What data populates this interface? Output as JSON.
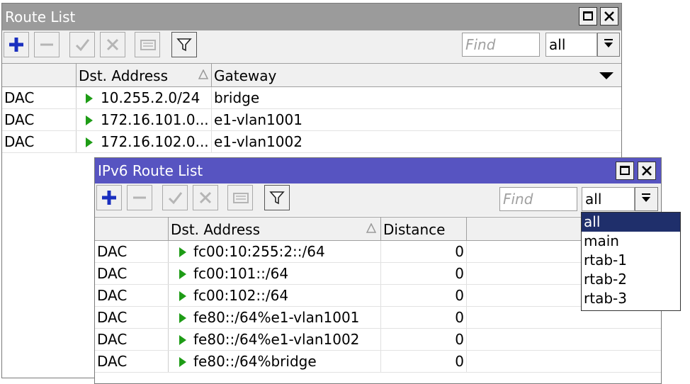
{
  "route_list": {
    "title": "Route List",
    "find_placeholder": "Find",
    "filter_value": "all",
    "columns": [
      "",
      "Dst. Address",
      "Gateway"
    ],
    "rows": [
      {
        "flags": "DAC",
        "dst": "10.255.2.0/24",
        "gateway": "bridge"
      },
      {
        "flags": "DAC",
        "dst": "172.16.101.0...",
        "gateway": "e1-vlan1001"
      },
      {
        "flags": "DAC",
        "dst": "172.16.102.0...",
        "gateway": "e1-vlan1002"
      }
    ]
  },
  "ipv6_route_list": {
    "title": "IPv6 Route List",
    "find_placeholder": "Find",
    "filter_value": "all",
    "columns": [
      "",
      "Dst. Address",
      "Distance"
    ],
    "rows": [
      {
        "flags": "DAC",
        "dst": "fc00:10:255:2::/64",
        "distance": "0"
      },
      {
        "flags": "DAC",
        "dst": "fc00:101::/64",
        "distance": "0"
      },
      {
        "flags": "DAC",
        "dst": "fc00:102::/64",
        "distance": "0"
      },
      {
        "flags": "DAC",
        "dst": "fe80::/64%e1-vlan1001",
        "distance": "0"
      },
      {
        "flags": "DAC",
        "dst": "fe80::/64%e1-vlan1002",
        "distance": "0"
      },
      {
        "flags": "DAC",
        "dst": "fe80::/64%bridge",
        "distance": "0"
      }
    ],
    "dropdown_options": [
      "all",
      "main",
      "rtab-1",
      "rtab-2",
      "rtab-3"
    ]
  },
  "icons": {
    "add": "plus-icon",
    "remove": "minus-icon",
    "enable": "check-icon",
    "disable": "x-icon",
    "comment": "note-icon",
    "filter": "funnel-icon",
    "maximize": "maximize-icon",
    "close": "close-icon",
    "sort": "sort-asc-icon",
    "expand": "chevron-down-icon",
    "row": "play-arrow-icon"
  },
  "colors": {
    "inactive_title": "#9b9b9b",
    "active_title": "#5754c1",
    "add_icon": "#1a2fbf",
    "row_arrow": "#1e9c16",
    "selected_option": "#1f2f6b"
  }
}
